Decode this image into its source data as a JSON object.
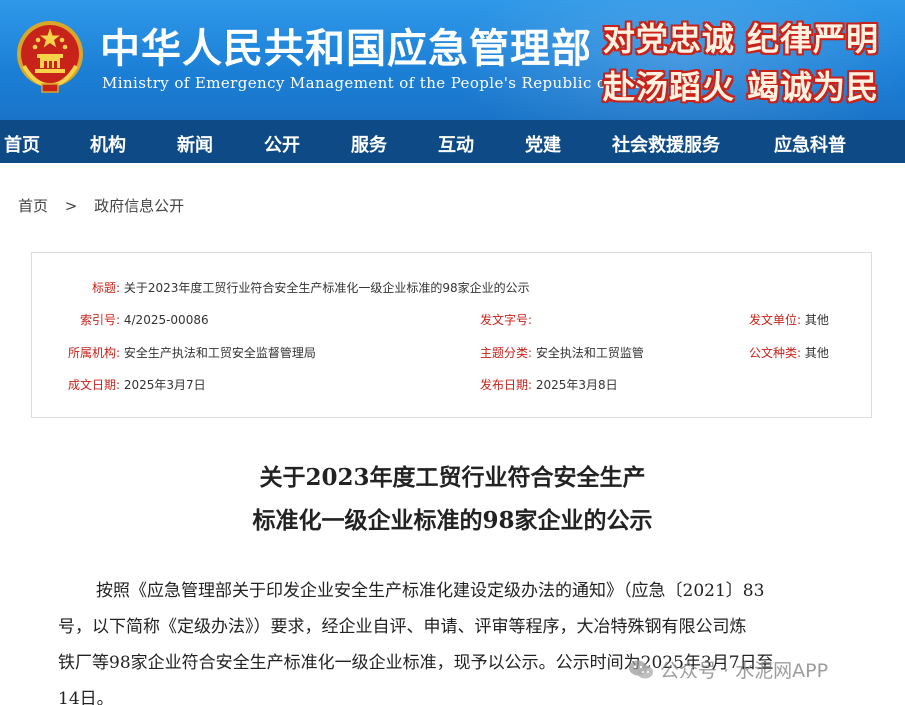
{
  "header": {
    "title_cn": "中华人民共和国应急管理部",
    "title_en": "Ministry of Emergency Management of the People's Republic of China",
    "slogan_line1": "对党忠诚 纪律严明",
    "slogan_line2": "赴汤蹈火 竭诚为民",
    "emblem_icon": "national-emblem-icon"
  },
  "nav": {
    "items": [
      "首页",
      "机构",
      "新闻",
      "公开",
      "服务",
      "互动",
      "党建",
      "社会救援服务",
      "应急科普"
    ]
  },
  "breadcrumb": {
    "home": "首页",
    "separator": ">",
    "current": "政府信息公开"
  },
  "info": {
    "title_label": "标题:",
    "title_value": "关于2023年度工贸行业符合安全生产标准化一级企业标准的98家企业的公示",
    "index_label": "索引号:",
    "index_value": "4/2025-00086",
    "docno_label": "发文字号:",
    "docno_value": "",
    "issuer_label": "发文单位:",
    "issuer_value": "其他",
    "org_label": "所属机构:",
    "org_value": "安全生产执法和工贸安全监督管理局",
    "topic_label": "主题分类:",
    "topic_value": "安全执法和工贸监管",
    "type_label": "公文种类:",
    "type_value": "其他",
    "created_label": "成文日期:",
    "created_value": "2025年3月7日",
    "published_label": "发布日期:",
    "published_value": "2025年3月8日"
  },
  "document": {
    "title_line1": "关于2023年度工贸行业符合安全生产",
    "title_line2": "标准化一级企业标准的98家企业的公示",
    "body_lines": [
      "按照《应急管理部关于印发企业安全生产标准化建设定级办法的通知》（应急〔2021〕83",
      "号，以下简称《定级办法》）要求，经企业自评、申请、评审等程序，大冶特殊钢有限公司炼",
      "铁厂等98家企业符合安全生产标准化一级企业标准，现予以公示。公示时间为2025年3月7日至",
      "14日。"
    ]
  },
  "watermark": {
    "text": "公众号 · 水泥网APP",
    "icon": "wechat-icon"
  },
  "colors": {
    "header_blue": "#1b7fd6",
    "nav_blue": "#0d4a86",
    "label_red": "#c8231b"
  }
}
